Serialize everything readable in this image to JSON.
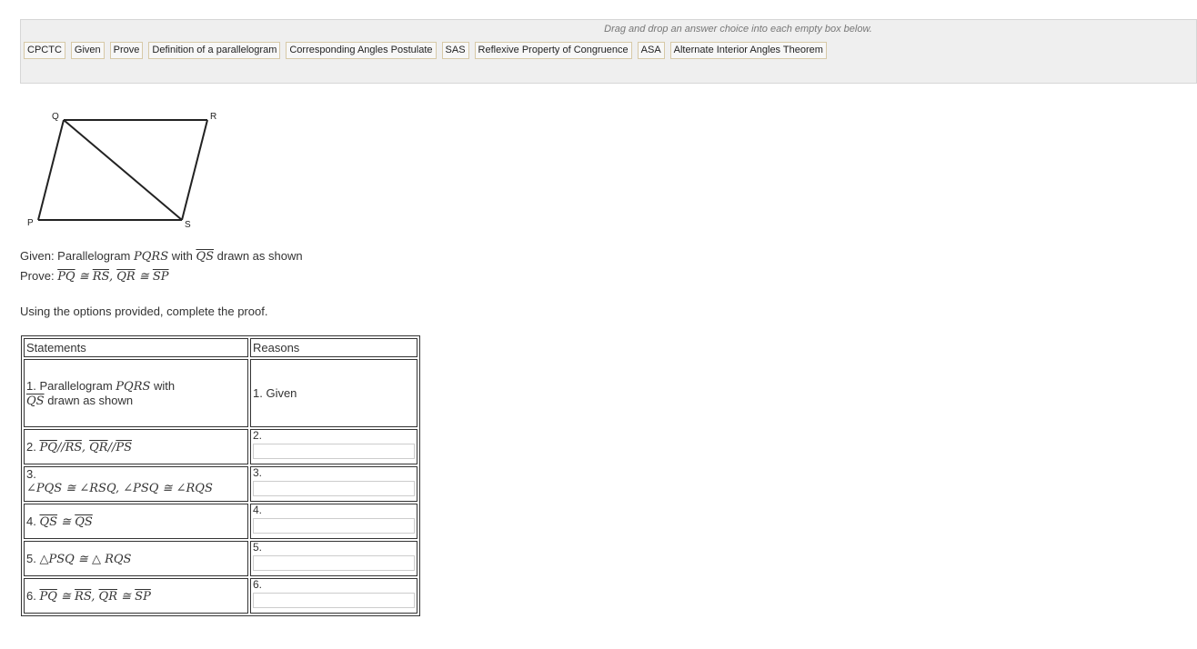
{
  "drag_panel": {
    "hint": "Drag and drop an answer choice into each empty box below.",
    "choices": [
      "CPCTC",
      "Given",
      "Prove",
      "Definition of a parallelogram",
      "Corresponding Angles Postulate",
      "SAS",
      "Reflexive Property of Congruence",
      "ASA",
      "Alternate Interior Angles Theorem"
    ]
  },
  "figure": {
    "vertices": {
      "P": "P",
      "Q": "Q",
      "R": "R",
      "S": "S"
    }
  },
  "given": {
    "prefix": "Given: Parallelogram ",
    "shape": "PQRS",
    "with": " with ",
    "segment": "QS",
    "suffix": " drawn as shown"
  },
  "prove": {
    "prefix": "Prove: ",
    "s1a": "PQ",
    "rel": " ≅ ",
    "s1b": "RS",
    "comma": ", ",
    "s2a": "QR",
    "s2b": "SP"
  },
  "instruction": "Using the options provided, complete the proof.",
  "table": {
    "headers": {
      "statements": "Statements",
      "reasons": "Reasons"
    },
    "rows": [
      {
        "num": "1. ",
        "reason": "1. Given"
      },
      {
        "num": "2. ",
        "reason_num": "2."
      },
      {
        "num": "3. ",
        "reason_num": "3."
      },
      {
        "num": "4. ",
        "reason_num": "4."
      },
      {
        "num": "5. ",
        "reason_num": "5."
      },
      {
        "num": "6. ",
        "reason_num": "6."
      }
    ],
    "s1": {
      "text1": "Parallelogram ",
      "shape": "PQRS",
      "with": " with",
      "seg": "QS",
      "text2": " drawn as shown"
    },
    "s2": {
      "a": "PQ",
      "par": "//",
      "b": "RS",
      "comma": ", ",
      "c": "QR",
      "d": "PS"
    },
    "s3": {
      "a1": "∠PQS",
      "rel": " ≅ ",
      "a2": "∠RSQ",
      "comma": ", ",
      "a3": "∠PSQ",
      "a4": "∠RQS"
    },
    "s4": {
      "a": "QS",
      "rel": " ≅ ",
      "b": "QS"
    },
    "s5": {
      "a": "△PSQ",
      "rel": " ≅ ",
      "b": "△ RQS"
    },
    "s6": {
      "a": "PQ",
      "rel": " ≅ ",
      "b": "RS",
      "comma": ", ",
      "c": "QR",
      "d": "SP"
    }
  }
}
